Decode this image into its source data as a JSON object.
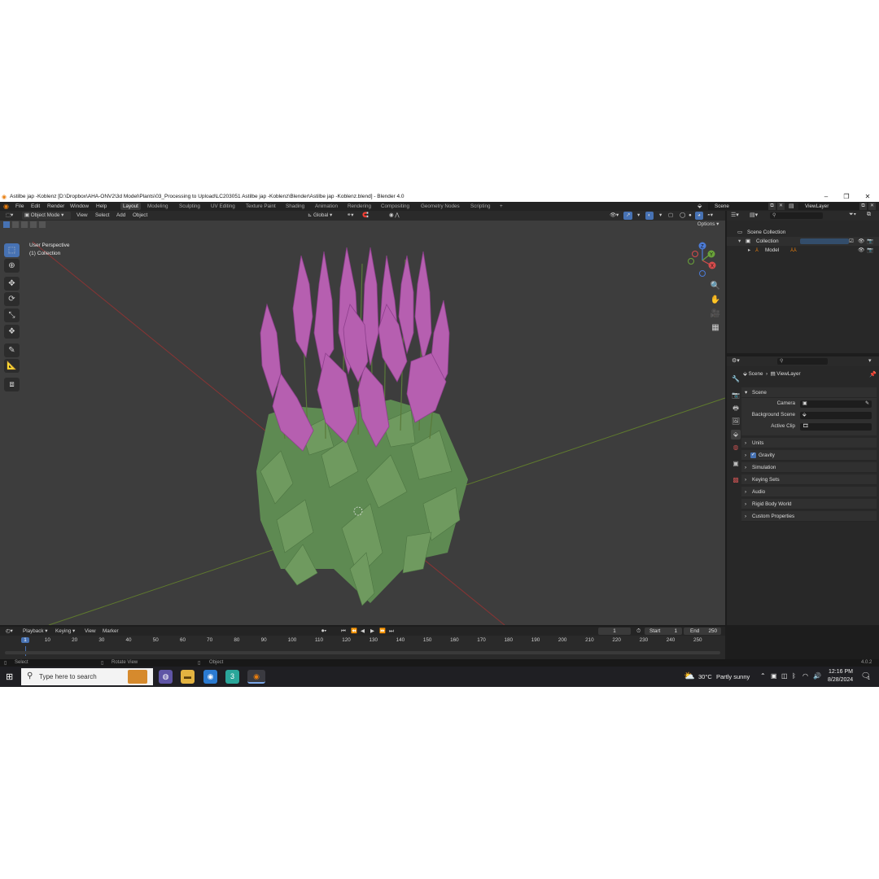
{
  "window": {
    "title": "Astilbe jap -Koblenz [D:\\Dropbox\\AHA-ONV2\\3d Model\\Plants\\03_Processing to Upload\\LC203051 Astilbe jap -Koblenz\\Blender\\Astilbe jap -Koblenz.blend] - Blender 4.0"
  },
  "menubar": {
    "items": [
      "File",
      "Edit",
      "Render",
      "Window",
      "Help"
    ],
    "workspaces": [
      "Layout",
      "Modeling",
      "Sculpting",
      "UV Editing",
      "Texture Paint",
      "Shading",
      "Animation",
      "Rendering",
      "Compositing",
      "Geometry Nodes",
      "Scripting"
    ],
    "active_workspace": "Layout",
    "add_tab": "+",
    "scene_label": "Scene",
    "viewlayer_label": "ViewLayer"
  },
  "viewport": {
    "mode": "Object Mode",
    "menus": [
      "View",
      "Select",
      "Add",
      "Object"
    ],
    "orientation": "Global",
    "options_label": "Options",
    "overlay_title": "User Perspective",
    "overlay_subtitle": "(1) Collection",
    "gizmo": {
      "x": "X",
      "y": "Y",
      "z": "Z"
    }
  },
  "outliner": {
    "root": "Scene Collection",
    "items": [
      {
        "label": "Collection",
        "depth": 1
      },
      {
        "label": "Model",
        "depth": 2
      }
    ]
  },
  "properties": {
    "breadcrumb_scene": "Scene",
    "breadcrumb_viewlayer": "ViewLayer",
    "panel_title": "Scene",
    "fields": [
      {
        "label": "Camera"
      },
      {
        "label": "Background Scene"
      },
      {
        "label": "Active Clip"
      }
    ],
    "sections": [
      "Units",
      "Gravity",
      "Simulation",
      "Keying Sets",
      "Audio",
      "Rigid Body World",
      "Custom Properties"
    ],
    "gravity_checked": true
  },
  "timeline": {
    "menus": [
      "Playback",
      "Keying",
      "View",
      "Marker"
    ],
    "current_frame": "1",
    "start_label": "Start",
    "start_value": "1",
    "end_label": "End",
    "end_value": "250",
    "ticks": [
      "1",
      "10",
      "20",
      "30",
      "40",
      "50",
      "60",
      "70",
      "80",
      "90",
      "100",
      "110",
      "120",
      "130",
      "140",
      "150",
      "160",
      "170",
      "180",
      "190",
      "200",
      "210",
      "220",
      "230",
      "240",
      "250"
    ]
  },
  "statusbar": {
    "select": "Select",
    "rotate": "Rotate View",
    "object": "Object",
    "version": "4.0.2"
  },
  "taskbar": {
    "search_placeholder": "Type here to search",
    "weather_temp": "30°C",
    "weather_desc": "Partly sunny",
    "time": "12:16 PM",
    "date": "8/28/2024",
    "notification_count": "1"
  }
}
